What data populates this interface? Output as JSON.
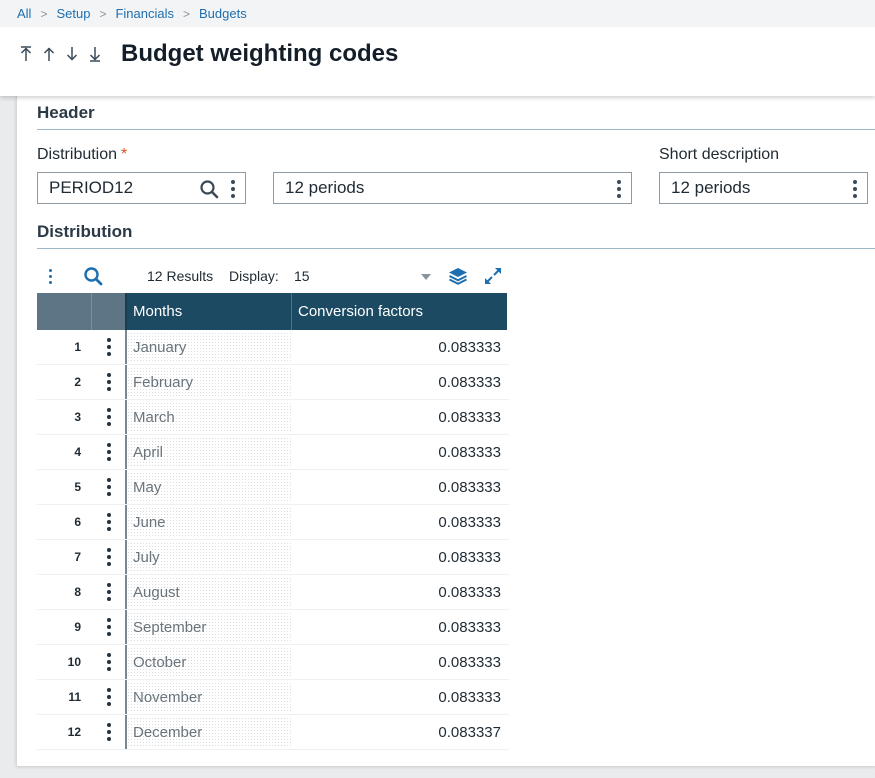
{
  "breadcrumb": [
    "All",
    "Setup",
    "Financials",
    "Budgets"
  ],
  "nav_icons": [
    "first-record-icon",
    "previous-record-icon",
    "next-record-icon",
    "last-record-icon"
  ],
  "page_title": "Budget weighting codes",
  "header_section": {
    "title": "Header"
  },
  "distribution_field": {
    "label": "Distribution",
    "required_marker": "*",
    "value": "PERIOD12",
    "description_value": "12 periods"
  },
  "short_description_field": {
    "label": "Short description",
    "value": "12 periods"
  },
  "distribution_section": {
    "title": "Distribution"
  },
  "grid": {
    "results_text": "12 Results",
    "display_label": "Display:",
    "display_value": "15",
    "columns": [
      "Months",
      "Conversion factors"
    ],
    "rows": [
      {
        "num": "1",
        "month": "January",
        "factor": "0.083333"
      },
      {
        "num": "2",
        "month": "February",
        "factor": "0.083333"
      },
      {
        "num": "3",
        "month": "March",
        "factor": "0.083333"
      },
      {
        "num": "4",
        "month": "April",
        "factor": "0.083333"
      },
      {
        "num": "5",
        "month": "May",
        "factor": "0.083333"
      },
      {
        "num": "6",
        "month": "June",
        "factor": "0.083333"
      },
      {
        "num": "7",
        "month": "July",
        "factor": "0.083333"
      },
      {
        "num": "8",
        "month": "August",
        "factor": "0.083333"
      },
      {
        "num": "9",
        "month": "September",
        "factor": "0.083333"
      },
      {
        "num": "10",
        "month": "October",
        "factor": "0.083333"
      },
      {
        "num": "11",
        "month": "November",
        "factor": "0.083333"
      },
      {
        "num": "12",
        "month": "December",
        "factor": "0.083337"
      }
    ]
  },
  "colors": {
    "accent": "#1d6fb0",
    "grid_header": "#1b4a62",
    "required": "#e0531b"
  }
}
